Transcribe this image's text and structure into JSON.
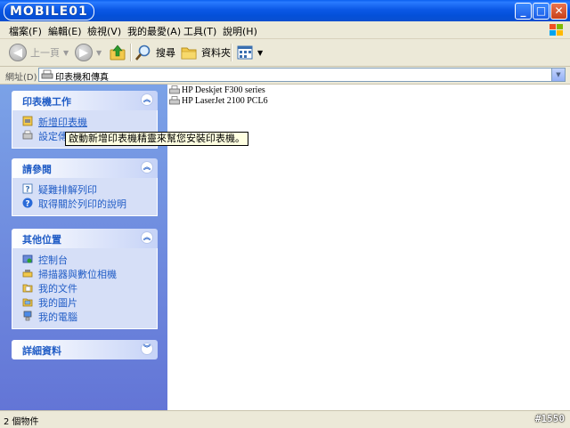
{
  "window": {
    "logo": "MOBILE01",
    "minimize": "_",
    "maximize": "□",
    "close": "✕"
  },
  "menu": [
    "檔案(F)",
    "編輯(E)",
    "檢視(V)",
    "我的最愛(A)",
    "工具(T)",
    "說明(H)"
  ],
  "toolbar": {
    "back": "上一頁",
    "search": "搜尋",
    "folders": "資料夾"
  },
  "address": {
    "label": "網址(D)",
    "value": "印表機和傳真"
  },
  "taskpane": {
    "printer_tasks": {
      "title": "印表機工作",
      "items": [
        "新增印表機",
        "設定傳真"
      ]
    },
    "see_also": {
      "title": "請參閱",
      "items": [
        "疑難排解列印",
        "取得關於列印的說明"
      ]
    },
    "other_places": {
      "title": "其他位置",
      "items": [
        "控制台",
        "掃描器與數位相機",
        "我的文件",
        "我的圖片",
        "我的電腦"
      ]
    },
    "details": {
      "title": "詳細資料"
    }
  },
  "files": [
    "HP Deskjet F300 series",
    "HP LaserJet 2100 PCL6"
  ],
  "tooltip": "啟動新增印表機精靈來幫您安裝印表機。",
  "status": {
    "text": "2 個物件",
    "watermark": "#1550"
  },
  "colors": {
    "titlebar": "#0450d8",
    "taskpane_link": "#215dc6",
    "panel_body": "#d6dff7"
  }
}
